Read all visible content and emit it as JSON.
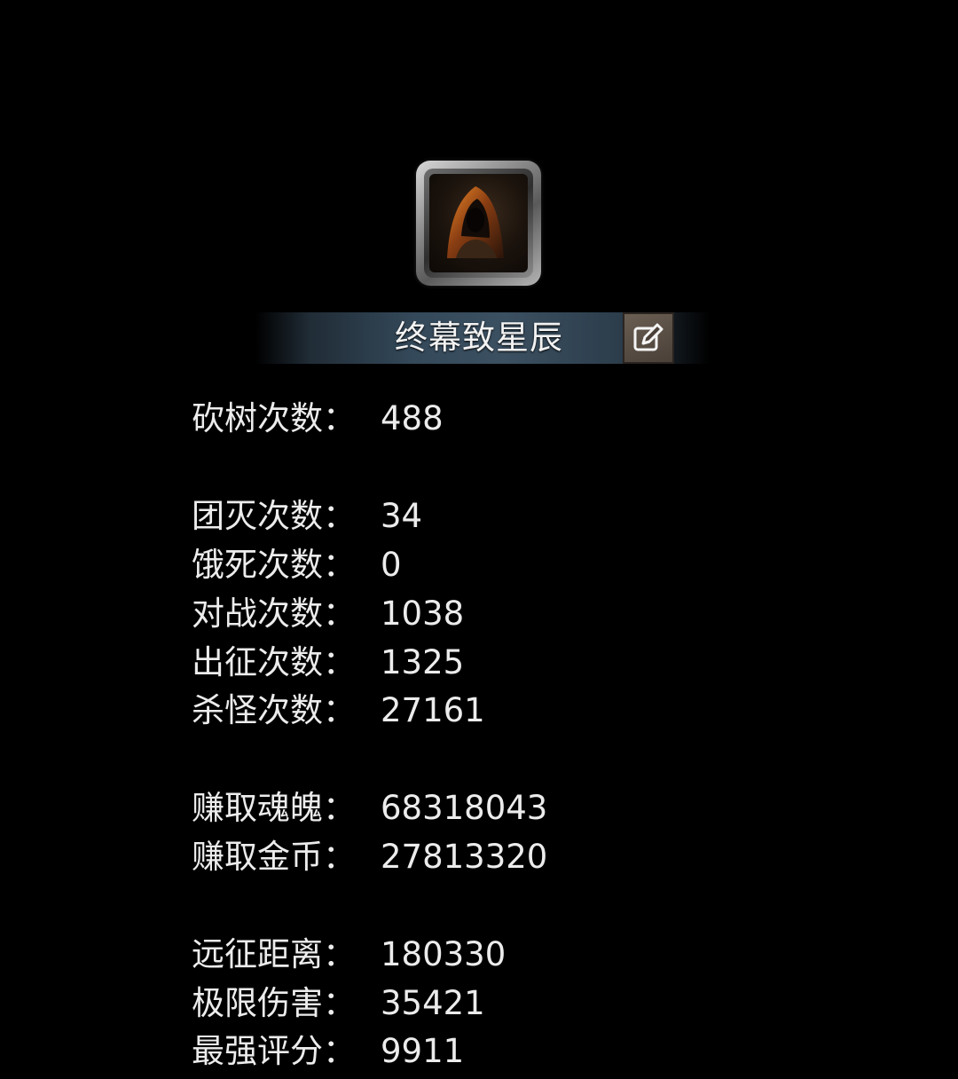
{
  "profile": {
    "name": "终幕致星辰",
    "avatar_icon": "hooded-figure-icon",
    "edit_icon": "edit-pencil-icon"
  },
  "stats": [
    {
      "label": "砍树次数：",
      "value": "488"
    },
    {
      "label": "团灭次数：",
      "value": "34"
    },
    {
      "label": "饿死次数：",
      "value": "0"
    },
    {
      "label": "对战次数：",
      "value": "1038"
    },
    {
      "label": "出征次数：",
      "value": "1325"
    },
    {
      "label": "杀怪次数：",
      "value": "27161"
    },
    {
      "label": "赚取魂魄：",
      "value": "68318043"
    },
    {
      "label": "赚取金币：",
      "value": "27813320"
    },
    {
      "label": "远征距离：",
      "value": "180330"
    },
    {
      "label": "极限伤害：",
      "value": "35421"
    },
    {
      "label": "最强评分：",
      "value": "9911"
    }
  ]
}
